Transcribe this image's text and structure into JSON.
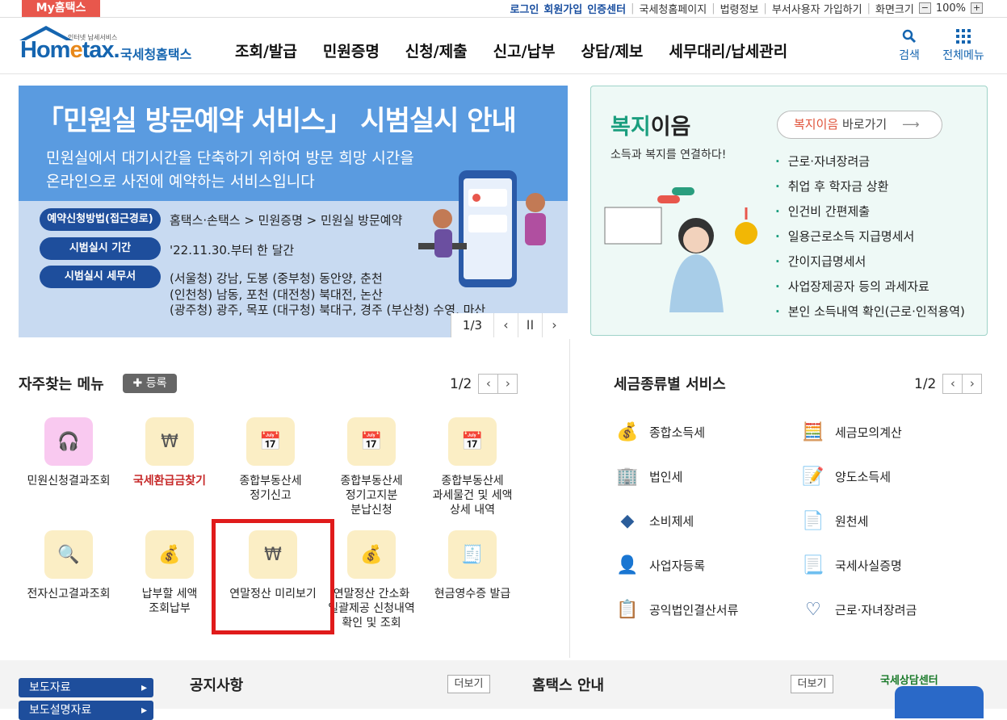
{
  "topbar": {
    "my_tab": "My홈택스",
    "links": [
      "로그인",
      "회원가입",
      "인증센터",
      "국세청홈페이지",
      "법령정보",
      "부서사용자 가입하기",
      "화면크기"
    ],
    "zoom": "100%",
    "zoom_minus": "−",
    "zoom_plus": "+"
  },
  "header": {
    "logo_tiny": "인터넷 납세서비스",
    "logo_home": "Hom",
    "logo_e": "e",
    "logo_tax": "tax.",
    "logo_service": "국세청홈택스",
    "gnb": [
      "조회/발급",
      "민원증명",
      "신청/제출",
      "신고/납부",
      "상담/제보",
      "세무대리/납세관리"
    ],
    "search_label": "검색",
    "menu_label": "전체메뉴"
  },
  "banner": {
    "title": "「민원실 방문예약 서비스」 시범실시 안내",
    "sub1": "민원실에서 대기시간을 단축하기 위하여 방문 희망 시간을",
    "sub2": "온라인으로 사전에 예약하는 서비스입니다",
    "rows": [
      {
        "pill": "예약신청방법(접근경로)",
        "text": "홈택스·손택스 > 민원증명 > 민원실 방문예약"
      },
      {
        "pill": "시범실시 기간",
        "text": "'22.11.30.부터 한 달간"
      },
      {
        "pill": "시범실시 세무서",
        "text": "(서울청) 강남, 도봉 (중부청) 동안양, 춘천"
      }
    ],
    "extra_lines": [
      "(인천청) 남동, 포천 (대전청) 북대전, 논산",
      "(광주청) 광주, 목포 (대구청) 북대구, 경주 (부산청) 수영, 마산"
    ],
    "page": "1/3",
    "prev": "‹",
    "pause": "II",
    "next": "›"
  },
  "welfare": {
    "title_green": "복지",
    "title_rest": "이음",
    "subtitle": "소득과 복지를 연결하다!",
    "btn_red": "복지이음",
    "btn_rest": " 바로가기",
    "items": [
      "근로·자녀장려금",
      "취업 후 학자금 상환",
      "인건비 간편제출",
      "일용근로소득 지급명세서",
      "간이지급명세서",
      "사업장제공자 등의 과세자료",
      "본인 소득내역 확인(근로·인적용역)"
    ]
  },
  "favorites": {
    "title": "자주찾는 메뉴",
    "add": "✚ 등록",
    "page": "1/2",
    "items": [
      {
        "label": "민원신청결과조회",
        "icon": "headset-icon"
      },
      {
        "label": "국세환급금찾기",
        "icon": "refund-icon"
      },
      {
        "label": "종합부동산세\n정기신고",
        "icon": "calendar-edit-icon"
      },
      {
        "label": "종합부동산세\n정기고지분\n분납신청",
        "icon": "calendar-check-icon"
      },
      {
        "label": "종합부동산세\n과세물건 및 세액\n상세 내역",
        "icon": "calendar-check-icon"
      },
      {
        "label": "전자신고결과조회",
        "icon": "search-doc-icon"
      },
      {
        "label": "납부할 세액\n조회납부",
        "icon": "money-bag-icon"
      },
      {
        "label": "연말정산 미리보기",
        "icon": "preview-icon"
      },
      {
        "label": "연말정산 간소화\n일괄제공 신청내역\n확인 및 조회",
        "icon": "money-bag-icon"
      },
      {
        "label": "현금영수증 발급",
        "icon": "receipt-icon"
      }
    ]
  },
  "tax_services": {
    "title": "세금종류별 서비스",
    "page": "1/2",
    "items": [
      {
        "label": "종합소득세",
        "icon": "money-bag-icon"
      },
      {
        "label": "세금모의계산",
        "icon": "calculator-icon"
      },
      {
        "label": "법인세",
        "icon": "building-icon"
      },
      {
        "label": "양도소득세",
        "icon": "document-edit-icon"
      },
      {
        "label": "소비제세",
        "icon": "diamond-icon"
      },
      {
        "label": "원천세",
        "icon": "salary-doc-icon"
      },
      {
        "label": "사업자등록",
        "icon": "person-icon"
      },
      {
        "label": "국세사실증명",
        "icon": "certificate-icon"
      },
      {
        "label": "공익법인결산서류",
        "icon": "clipboard-icon"
      },
      {
        "label": "근로·자녀장려금",
        "icon": "heart-icon"
      }
    ]
  },
  "bottom": {
    "side1": "보도자료",
    "side2": "보도설명자료",
    "notice": "공지사항",
    "guide": "홈택스 안내",
    "more": "더보기",
    "center": "국세상담센터"
  }
}
